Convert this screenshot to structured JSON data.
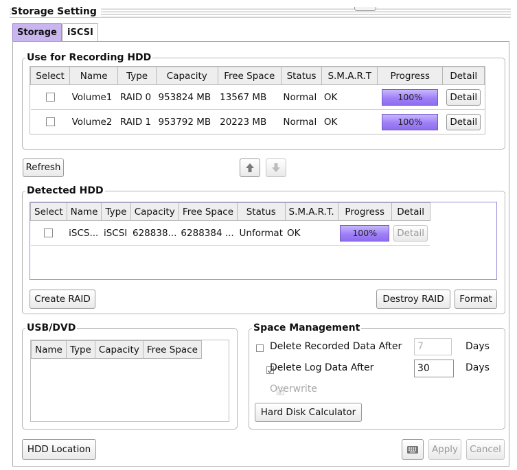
{
  "window": {
    "title": "Storage Setting"
  },
  "tabs": [
    {
      "label": "Storage"
    },
    {
      "label": "iSCSI"
    }
  ],
  "recording": {
    "legend": "Use for Recording HDD",
    "columns": [
      "Select",
      "Name",
      "Type",
      "Capacity",
      "Free Space",
      "Status",
      "S.M.A.R.T",
      "Progress",
      "Detail"
    ],
    "rows": [
      {
        "name": "Volume1",
        "type": "RAID 0",
        "capacity": "953824 MB",
        "free": "13567 MB",
        "status": "Normal",
        "smart": "OK",
        "progress": "100%",
        "detail": "Detail"
      },
      {
        "name": "Volume2",
        "type": "RAID 1",
        "capacity": "953792 MB",
        "free": "20223 MB",
        "status": "Normal",
        "smart": "OK",
        "progress": "100%",
        "detail": "Detail"
      }
    ]
  },
  "refresh_label": "Refresh",
  "icons": {
    "up": "arrow-up-icon",
    "down": "arrow-down-icon",
    "keyboard": "keyboard-icon"
  },
  "detected": {
    "legend": "Detected HDD",
    "columns": [
      "Select",
      "Name",
      "Type",
      "Capacity",
      "Free Space",
      "Status",
      "S.M.A.R.T.",
      "Progress",
      "Detail"
    ],
    "rows": [
      {
        "name": "iSCS...",
        "type": "iSCSI",
        "capacity": "628838...",
        "free": "6288384 ...",
        "status": "Unformat",
        "smart": "OK",
        "progress": "100%",
        "detail": "Detail"
      }
    ]
  },
  "create_raid_label": "Create RAID",
  "destroy_raid_label": "Destroy RAID",
  "format_label": "Format",
  "usb": {
    "legend": "USB/DVD",
    "columns": [
      "Name",
      "Type",
      "Capacity",
      "Free Space"
    ]
  },
  "space": {
    "legend": "Space Management",
    "delete_recorded_label": "Delete Recorded Data After",
    "delete_recorded_value": "7",
    "delete_log_label": "Delete Log Data After",
    "delete_log_value": "30",
    "days_label": "Days",
    "overwrite_label": "Overwrite",
    "calculator_label": "Hard Disk Calculator"
  },
  "hdd_location_label": "HDD Location",
  "apply_label": "Apply",
  "cancel_label": "Cancel",
  "colors": {
    "accent": "#c9b6ef",
    "progress": "#9f80f7"
  }
}
